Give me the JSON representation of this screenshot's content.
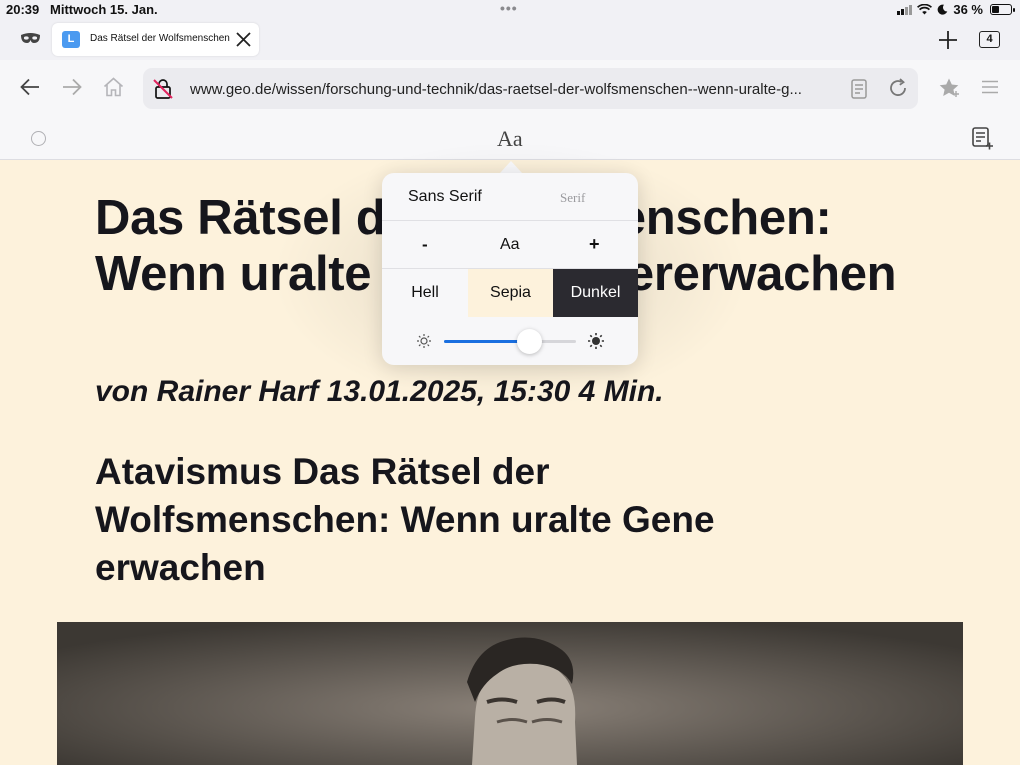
{
  "status_bar": {
    "time": "20:39",
    "date": "Mittwoch 15. Jan.",
    "battery_percent": "36 %",
    "battery_level": 0.36
  },
  "tab_bar": {
    "private_icon": "mask-icon",
    "active_tab": {
      "favicon_letter": "L",
      "favicon_color": "#4b9af0",
      "title": "Das Rätsel der Wolfsmenschen"
    },
    "tab_count": "4"
  },
  "url_bar": {
    "url": "www.geo.de/wissen/forschung-und-technik/das-raetsel-der-wolfsmenschen--wenn-uralte-g..."
  },
  "reader_toolbar": {
    "text_settings_label": "Aa"
  },
  "article": {
    "title": "Das Rätsel der Wolfsmenschen: Wenn uralte Gene wiedererwachen",
    "byline": "von Rainer Harf 13.01.2025, 15:30 4 Min.",
    "subtitle": "Atavismus Das Rätsel der Wolfsmenschen: Wenn uralte Gene erwachen",
    "background_color": "#fdf2dc"
  },
  "text_popover": {
    "font_options": {
      "sans": "Sans Serif",
      "serif": "Serif",
      "selected": "Sans Serif"
    },
    "size_controls": {
      "decrease": "-",
      "label": "Aa",
      "increase": "+"
    },
    "themes": [
      {
        "label": "Hell",
        "color": "#f7f7f9"
      },
      {
        "label": "Sepia",
        "color": "#fdf2dc"
      },
      {
        "label": "Dunkel",
        "color": "#2b2a30"
      }
    ],
    "brightness": 0.65,
    "accent_color": "#1a6fe0"
  }
}
